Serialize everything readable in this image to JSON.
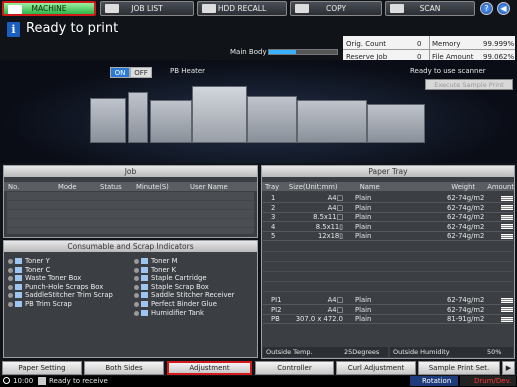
{
  "tabs": [
    {
      "label": "MACHINE",
      "active": true
    },
    {
      "label": "JOB LIST",
      "active": false
    },
    {
      "label": "HDD RECALL",
      "active": false
    },
    {
      "label": "COPY",
      "active": false
    },
    {
      "label": "SCAN",
      "active": false
    }
  ],
  "status": {
    "text": "Ready to print",
    "info_icon": "info-icon"
  },
  "main_body_label": "Main Body",
  "counter": {
    "orig_label": "Orig. Count",
    "orig_value": "0",
    "memory_label": "Memory",
    "memory_value": "99.999%",
    "reserve_label": "Reserve Job",
    "reserve_value": "0",
    "file_label": "File Amount",
    "file_value": "99.062%"
  },
  "pb_heater": {
    "on": "ON",
    "off": "OFF",
    "label": "PB Heater"
  },
  "scanner_status": "Ready to use scanner",
  "execute_sample": "Execute Sample Print",
  "job": {
    "title": "Job",
    "cols": [
      "No.",
      "Mode",
      "Status",
      "Minute(S)",
      "User Name"
    ]
  },
  "consumables": {
    "title": "Consumable and Scrap Indicators",
    "left": [
      "Toner Y",
      "Toner C",
      "Waste Toner Box",
      "Punch-Hole Scraps Box",
      "SaddleStitcher Trim Scrap",
      "PB Trim Scrap"
    ],
    "right": [
      "Toner M",
      "Toner K",
      "Staple Cartridge",
      "Staple Scrap Box",
      "Saddle Stitcher Receiver",
      "Perfect Binder Glue",
      "Humidifier Tank"
    ]
  },
  "paper_tray": {
    "title": "Paper Tray",
    "cols": [
      "Tray",
      "Size(Unit:mm)",
      "Name",
      "Weight",
      "Amount"
    ],
    "rows": [
      {
        "tray": "1",
        "size": "A4□",
        "name": "Plain",
        "weight": "62-74g/m2"
      },
      {
        "tray": "2",
        "size": "A4□",
        "name": "Plain",
        "weight": "62-74g/m2"
      },
      {
        "tray": "3",
        "size": "8.5x11□",
        "name": "Plain",
        "weight": "62-74g/m2"
      },
      {
        "tray": "4",
        "size": "8.5x11▯",
        "name": "Plain",
        "weight": "62-74g/m2"
      },
      {
        "tray": "5",
        "size": "12x18▯",
        "name": "Plain",
        "weight": "62-74g/m2"
      }
    ],
    "rows2": [
      {
        "tray": "PI1",
        "size": "A4□",
        "name": "Plain",
        "weight": "62-74g/m2"
      },
      {
        "tray": "PI2",
        "size": "A4□",
        "name": "Plain",
        "weight": "62-74g/m2"
      },
      {
        "tray": "PB",
        "size": "307.0 x 472.0",
        "name": "Plain",
        "weight": "81-91g/m2"
      }
    ],
    "outside_temp_label": "Outside Temp.",
    "outside_temp_value": "25Degrees",
    "outside_hum_label": "Outside Humidity",
    "outside_hum_value": "50%"
  },
  "bottom_tabs": [
    "Paper Setting",
    "Both Sides",
    "Adjustment",
    "Controller",
    "Curl Adjustment",
    "Sample Print Set."
  ],
  "footer": {
    "time": "10:00",
    "status": "Ready to receive",
    "rotation": "Rotation",
    "drum": "Drum/Dev."
  },
  "colors": {
    "active_tab": "#3fbf4f",
    "highlight": "#d21a1a",
    "panel": "#3b3f44"
  }
}
